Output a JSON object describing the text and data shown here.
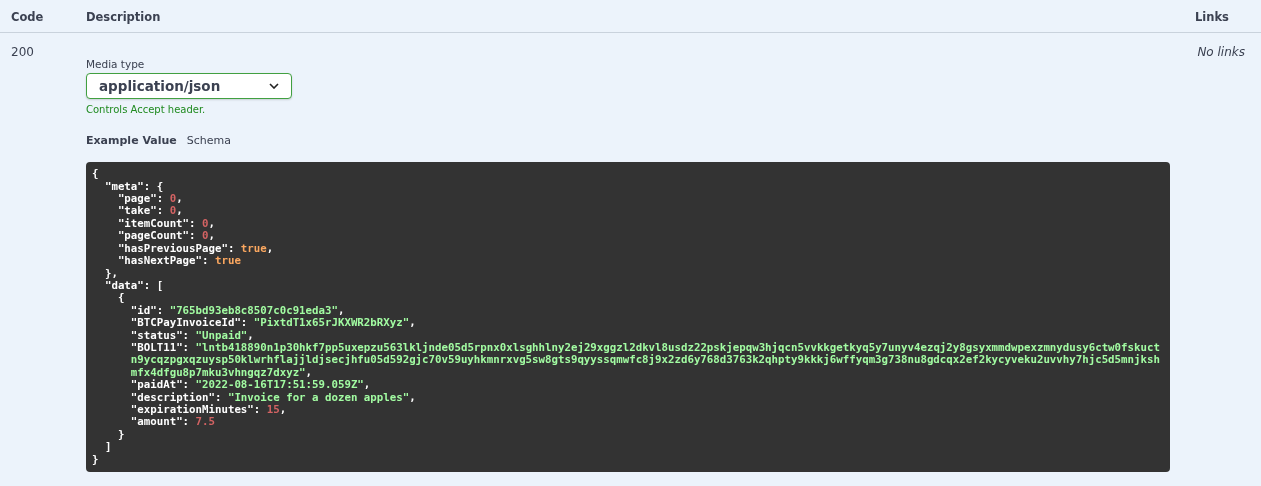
{
  "columns": [
    "Code",
    "Description",
    "Links"
  ],
  "responses": [
    {
      "code": "200",
      "media_label": "Media type",
      "media_type": "application/json",
      "hint": "Controls Accept header.",
      "links": "No links",
      "tabs": [
        {
          "label": "Example Value",
          "selected": true
        },
        {
          "label": "Schema",
          "selected": false
        }
      ],
      "example_lines": [
        [
          {
            "kind": "punct",
            "t": "{"
          }
        ],
        [
          {
            "kind": "key",
            "t": "\"meta\""
          },
          {
            "kind": "punct",
            "t": ": {"
          }
        ],
        [
          {
            "kind": "key",
            "t": "\"page\""
          },
          {
            "kind": "punct",
            "t": ": "
          },
          {
            "kind": "number",
            "t": "0"
          },
          {
            "kind": "punct",
            "t": ","
          }
        ],
        [
          {
            "kind": "key",
            "t": "\"take\""
          },
          {
            "kind": "punct",
            "t": ": "
          },
          {
            "kind": "number",
            "t": "0"
          },
          {
            "kind": "punct",
            "t": ","
          }
        ],
        [
          {
            "kind": "key",
            "t": "\"itemCount\""
          },
          {
            "kind": "punct",
            "t": ": "
          },
          {
            "kind": "number",
            "t": "0"
          },
          {
            "kind": "punct",
            "t": ","
          }
        ],
        [
          {
            "kind": "key",
            "t": "\"pageCount\""
          },
          {
            "kind": "punct",
            "t": ": "
          },
          {
            "kind": "number",
            "t": "0"
          },
          {
            "kind": "punct",
            "t": ","
          }
        ],
        [
          {
            "kind": "key",
            "t": "\"hasPreviousPage\""
          },
          {
            "kind": "punct",
            "t": ": "
          },
          {
            "kind": "boolean",
            "t": "true"
          },
          {
            "kind": "punct",
            "t": ","
          }
        ],
        [
          {
            "kind": "key",
            "t": "\"hasNextPage\""
          },
          {
            "kind": "punct",
            "t": ": "
          },
          {
            "kind": "boolean",
            "t": "true"
          }
        ],
        [
          {
            "kind": "punct",
            "t": "},"
          }
        ],
        [
          {
            "kind": "key",
            "t": "\"data\""
          },
          {
            "kind": "punct",
            "t": ": ["
          }
        ],
        [
          {
            "kind": "punct",
            "t": "{"
          }
        ],
        [
          {
            "kind": "key",
            "t": "\"id\""
          },
          {
            "kind": "punct",
            "t": ": "
          },
          {
            "kind": "string",
            "t": "\"765bd93eb8c8507c0c91eda3\""
          },
          {
            "kind": "punct",
            "t": ","
          }
        ],
        [
          {
            "kind": "key",
            "t": "\"BTCPayInvoiceId\""
          },
          {
            "kind": "punct",
            "t": ": "
          },
          {
            "kind": "string",
            "t": "\"PixtdT1x65rJKXWR2bRXyz\""
          },
          {
            "kind": "punct",
            "t": ","
          }
        ],
        [
          {
            "kind": "key",
            "t": "\"status\""
          },
          {
            "kind": "punct",
            "t": ": "
          },
          {
            "kind": "string",
            "t": "\"Unpaid\""
          },
          {
            "kind": "punct",
            "t": ","
          }
        ],
        [
          {
            "kind": "key",
            "t": "\"BOLT11\""
          },
          {
            "kind": "punct",
            "t": ": "
          },
          {
            "kind": "string",
            "t": "\"lntb418890n1p30hkf7pp5uxepzu563lkljnde05d5rpnx0xlsghhlny2ej29xggzl2dkvl8usdz22pskjepqw3hjqcn5vvkkgetkyq5y7unyv4ezqj2y8gsyxmmdwpexzmnydusy6ctw0fskuctn9ycqzpgxqzuysp50klwrhflajjldjsecjhfu05d592gjc70v59uyhkmnrxvg5sw8gts9qyyssqmwfc8j9x2zd6y768d3763k2qhpty9kkkj6wffyqm3g738nu8gdcqx2ef2kycyveku2uvvhy7hjc5d5mnjkshmfx4dfgu8p7mku3vhngqz7dxyz\""
          },
          {
            "kind": "punct",
            "t": ","
          }
        ],
        [
          {
            "kind": "key",
            "t": "\"paidAt\""
          },
          {
            "kind": "punct",
            "t": ": "
          },
          {
            "kind": "string",
            "t": "\"2022-08-16T17:51:59.059Z\""
          },
          {
            "kind": "punct",
            "t": ","
          }
        ],
        [
          {
            "kind": "key",
            "t": "\"description\""
          },
          {
            "kind": "punct",
            "t": ": "
          },
          {
            "kind": "string",
            "t": "\"Invoice for a dozen apples\""
          },
          {
            "kind": "punct",
            "t": ","
          }
        ],
        [
          {
            "kind": "key",
            "t": "\"expirationMinutes\""
          },
          {
            "kind": "punct",
            "t": ": "
          },
          {
            "kind": "number",
            "t": "15"
          },
          {
            "kind": "punct",
            "t": ","
          }
        ],
        [
          {
            "kind": "key",
            "t": "\"amount\""
          },
          {
            "kind": "punct",
            "t": ": "
          },
          {
            "kind": "number",
            "t": "7.5"
          }
        ],
        [
          {
            "kind": "punct",
            "t": "}"
          }
        ],
        [
          {
            "kind": "punct",
            "t": "]"
          }
        ],
        [
          {
            "kind": "punct",
            "t": "}"
          }
        ]
      ]
    }
  ]
}
